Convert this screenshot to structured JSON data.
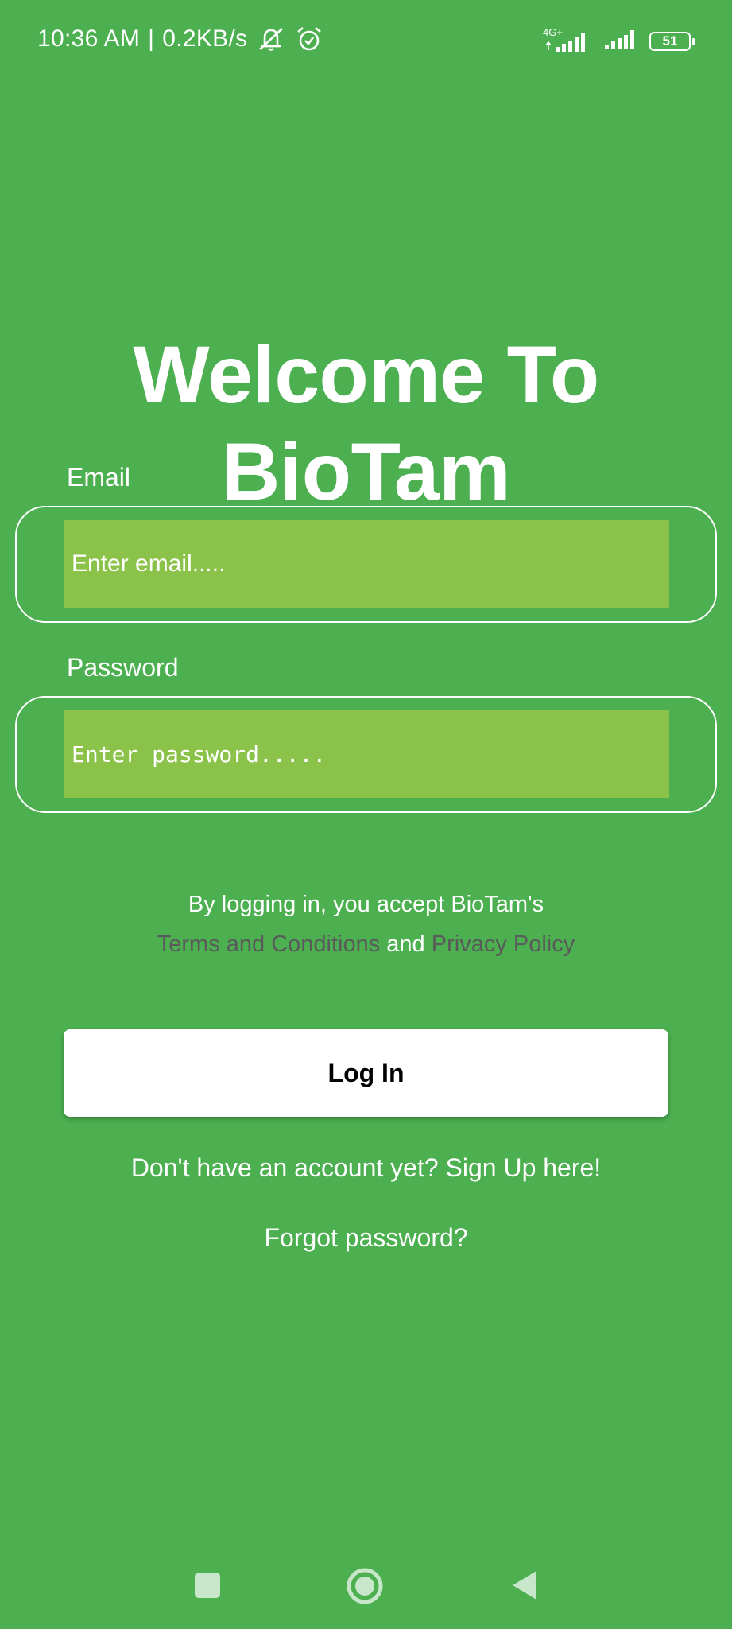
{
  "status_bar": {
    "time": "10:36 AM",
    "separator": "|",
    "speed": "0.2KB/s",
    "network_type": "4G+",
    "battery": "51"
  },
  "title": "Welcome To BioTam",
  "email": {
    "label": "Email",
    "placeholder": "Enter email....."
  },
  "password": {
    "label": "Password",
    "placeholder": "Enter password....."
  },
  "terms": {
    "line1": "By logging in, you accept BioTam's",
    "terms_link": "Terms and Conditions",
    "and": "and",
    "privacy_link": "Privacy Policy"
  },
  "login_button": "Log In",
  "signup_link": "Don't have an account yet? Sign Up here!",
  "forgot_link": "Forgot password?",
  "colors": {
    "background": "#4caf50",
    "input_fill": "#8bc34a",
    "link_text": "#5a5a5a",
    "button_bg": "#ffffff"
  },
  "icons": {
    "mute": "bell-off-icon",
    "alarm": "alarm-icon",
    "signal": "signal-icon",
    "battery": "battery-icon",
    "nav_recents": "square-icon",
    "nav_home": "circle-icon",
    "nav_back": "triangle-back-icon"
  }
}
